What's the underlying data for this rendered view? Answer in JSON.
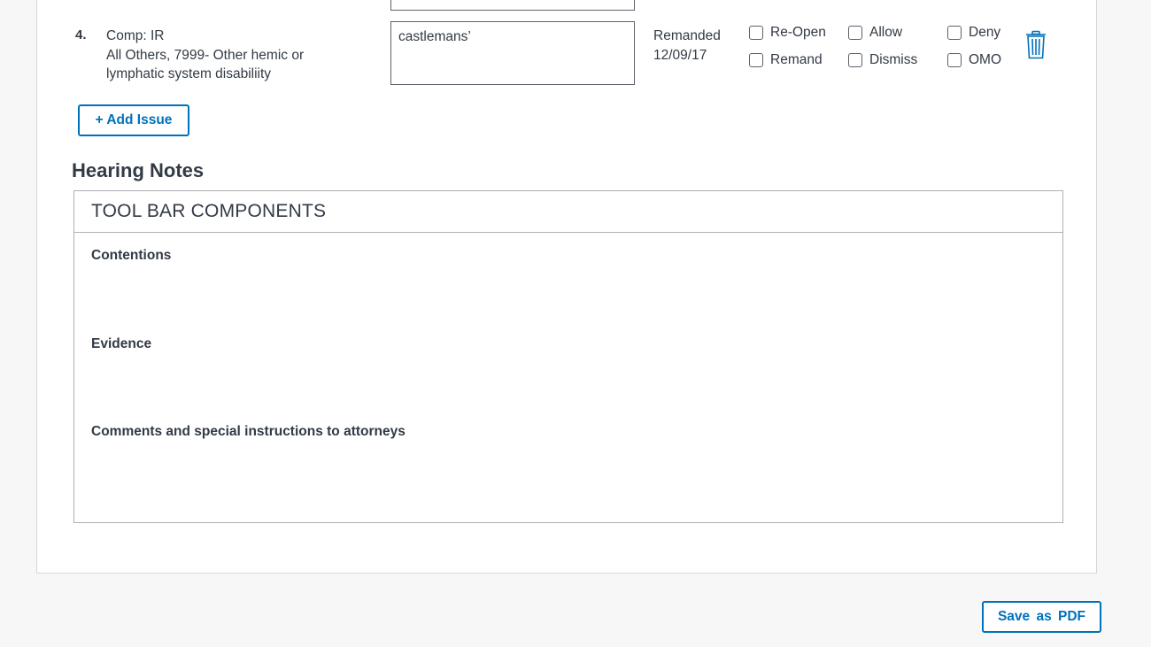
{
  "issue": {
    "number": "4.",
    "program_line": "Comp: IR",
    "description_line1": "All Others, 7999- Other hemic or",
    "description_line2": "lymphatic system disabiliity",
    "note_value": "castlemans’",
    "status_label": "Remanded",
    "status_date": "12/09/17",
    "dispositions": {
      "reopen": "Re-Open",
      "allow": "Allow",
      "deny": "Deny",
      "remand": "Remand",
      "dismiss": "Dismiss",
      "omo": "OMO"
    },
    "delete_icon": "trash-icon"
  },
  "add_issue_label": "+ Add Issue",
  "hearing_notes": {
    "title": "Hearing Notes",
    "toolbar_label": "TOOL BAR COMPONENTS",
    "sections": {
      "contentions": "Contentions",
      "evidence": "Evidence",
      "comments": "Comments and special instructions to attorneys"
    }
  },
  "save_pdf_label": "Save as  PDF",
  "colors": {
    "accent": "#0071bb",
    "text": "#323a45",
    "border": "#aeb0b5",
    "background": "#f7f7f7"
  }
}
